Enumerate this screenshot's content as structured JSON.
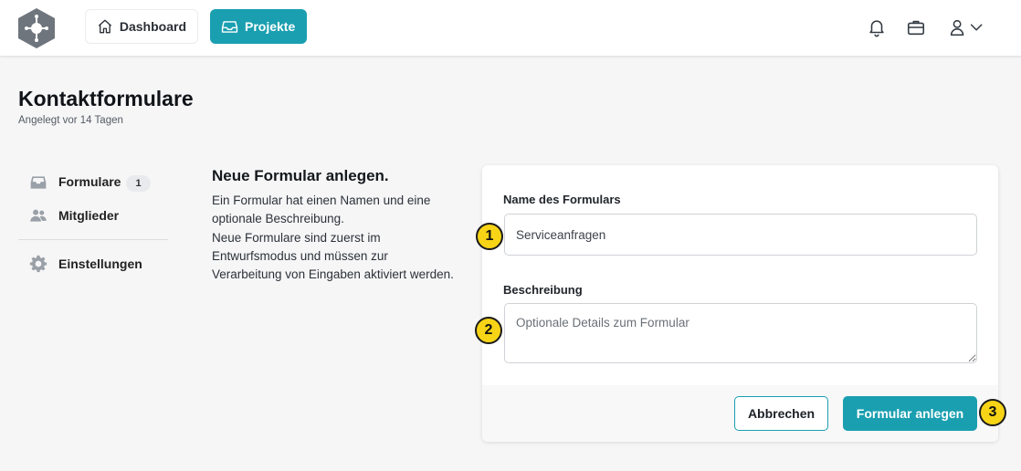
{
  "header": {
    "nav": {
      "dashboard_label": "Dashboard",
      "projekte_label": "Projekte"
    },
    "icons": [
      "logo-icon",
      "home-icon",
      "inbox-icon",
      "bell-icon",
      "briefcase-icon",
      "user-icon",
      "chevron-down-icon"
    ]
  },
  "page": {
    "title": "Kontaktformulare",
    "subtitle": "Angelegt vor 14 Tagen"
  },
  "sidebar": {
    "items": [
      {
        "label": "Formulare",
        "badge": "1",
        "icon": "inbox-icon"
      },
      {
        "label": "Mitglieder",
        "icon": "users-icon"
      },
      {
        "label": "Einstellungen",
        "icon": "gear-icon"
      }
    ]
  },
  "intro": {
    "title": "Neue Formular anlegen.",
    "text": "Ein Formular hat einen Namen und eine optionale Beschreibung.\nNeue Formulare sind zuerst im Entwurfsmodus und müssen zur Verarbeitung von Eingaben aktiviert werden."
  },
  "form": {
    "name_label": "Name des Formulars",
    "name_value": "Serviceanfragen",
    "desc_label": "Beschreibung",
    "desc_placeholder": "Optionale Details zum Formular",
    "cancel_label": "Abbrechen",
    "submit_label": "Formular anlegen"
  },
  "markers": [
    "1",
    "2",
    "3"
  ],
  "colors": {
    "accent": "#1a9fb0",
    "marker": "#f7d416"
  }
}
